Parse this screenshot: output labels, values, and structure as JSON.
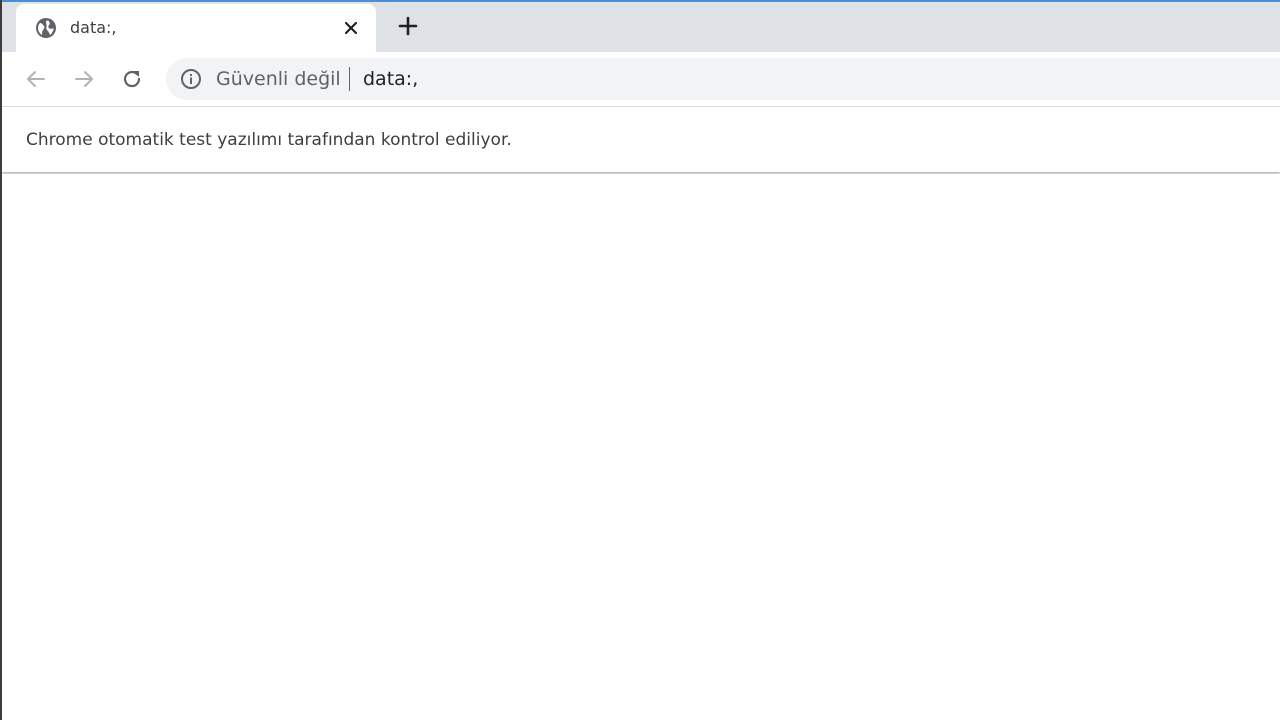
{
  "tab": {
    "title": "data:,",
    "favicon": "globe-icon",
    "close_icon": "close-icon"
  },
  "new_tab_icon": "plus-icon",
  "toolbar": {
    "back_icon": "arrow-back-icon",
    "forward_icon": "arrow-forward-icon",
    "reload_icon": "reload-icon"
  },
  "omnibox": {
    "security_icon": "info-icon",
    "security_label": "Güvenli değil",
    "url": "data:,"
  },
  "infobar": {
    "message": "Chrome otomatik test yazılımı tarafından kontrol ediliyor."
  },
  "colors": {
    "tabstrip": "#dee1e6",
    "accent": "#4a8fd6",
    "omnibox": "#f1f3f4",
    "icon": "#5f6368",
    "icon_disabled": "#b0b3b7"
  }
}
